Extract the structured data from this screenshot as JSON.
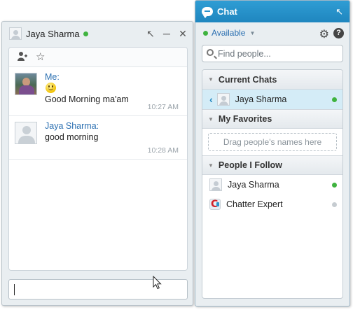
{
  "conversation": {
    "title": "Jaya Sharma",
    "icons": {
      "popout": "popout-icon",
      "minimize": "minimize-icon",
      "close": "close-icon"
    },
    "toolbar": {
      "add_person_icon": "add-person-icon",
      "favorite_icon": "star-icon"
    },
    "messages": [
      {
        "sender": "Me:",
        "emoticon": "smiley",
        "text": "Good Morning ma'am",
        "time": "10:27 AM"
      },
      {
        "sender": "Jaya Sharma:",
        "text": "good morning",
        "time": "10:28 AM"
      }
    ],
    "input_value": ""
  },
  "chat": {
    "title": "Chat",
    "status": "Available",
    "search_placeholder": "Find people...",
    "sections": {
      "current_chats": {
        "label": "Current Chats",
        "items": [
          {
            "name": "Jaya Sharma",
            "status": "online"
          }
        ]
      },
      "favorites": {
        "label": "My Favorites",
        "empty_hint": "Drag people's names here"
      },
      "following": {
        "label": "People I Follow",
        "items": [
          {
            "name": "Jaya Sharma",
            "status": "online"
          },
          {
            "name": "Chatter Expert",
            "status": "offline"
          }
        ]
      }
    }
  },
  "colors": {
    "header_blue": "#1f86bf",
    "link_blue": "#2a6fb1",
    "online_green": "#3fb33f",
    "offline_gray": "#c6ccd1"
  }
}
